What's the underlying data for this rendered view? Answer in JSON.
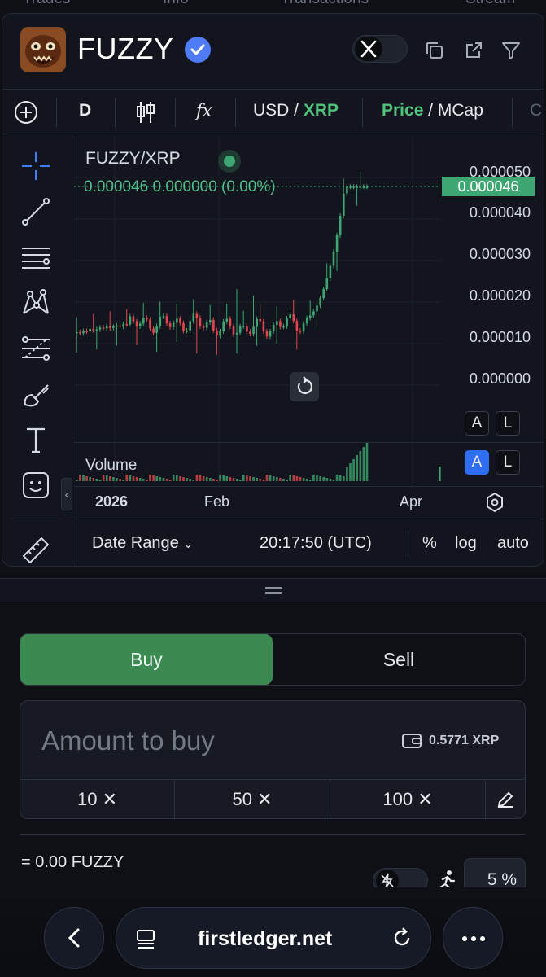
{
  "top_tabs": [
    "Trades",
    "Info",
    "Transactions",
    "Stream"
  ],
  "token": {
    "name": "FUZZY",
    "verified": true
  },
  "toolbar": {
    "interval": "D",
    "fx_label": "fx",
    "quote_left": "USD",
    "quote_sep": " / ",
    "quote_right": "XRP",
    "mode_left": "Price",
    "mode_sep": " / ",
    "mode_right": "MCap",
    "more": "C"
  },
  "chart": {
    "pair": "FUZZY/XRP",
    "ohlc": "0.000046  0.000000 (0.00%)",
    "last_price": "0.000046",
    "volume_label": "Volume",
    "price_axis": [
      "0.000050",
      "0.000040",
      "0.000030",
      "0.000020",
      "0.000010",
      "0.000000"
    ],
    "date_axis": [
      "2026",
      "Feb",
      "Apr"
    ],
    "scale_buttons": {
      "a": "A",
      "l": "L"
    },
    "date_range": "Date Range",
    "clock": "20:17:50 (UTC)",
    "pct": "%",
    "log": "log",
    "auto": "auto"
  },
  "colors": {
    "up": "#3ea672",
    "down": "#e2474f",
    "buy": "#3a8a52",
    "accent": "#2f6df2"
  },
  "trade": {
    "buy_label": "Buy",
    "sell_label": "Sell",
    "amount_placeholder": "Amount to buy",
    "balance": "0.5771 XRP",
    "quick": [
      "10",
      "50",
      "100"
    ],
    "receive": "= 0.00 FUZZY",
    "slippage": "5 %"
  },
  "browser": {
    "url": "firstledger.net"
  }
}
